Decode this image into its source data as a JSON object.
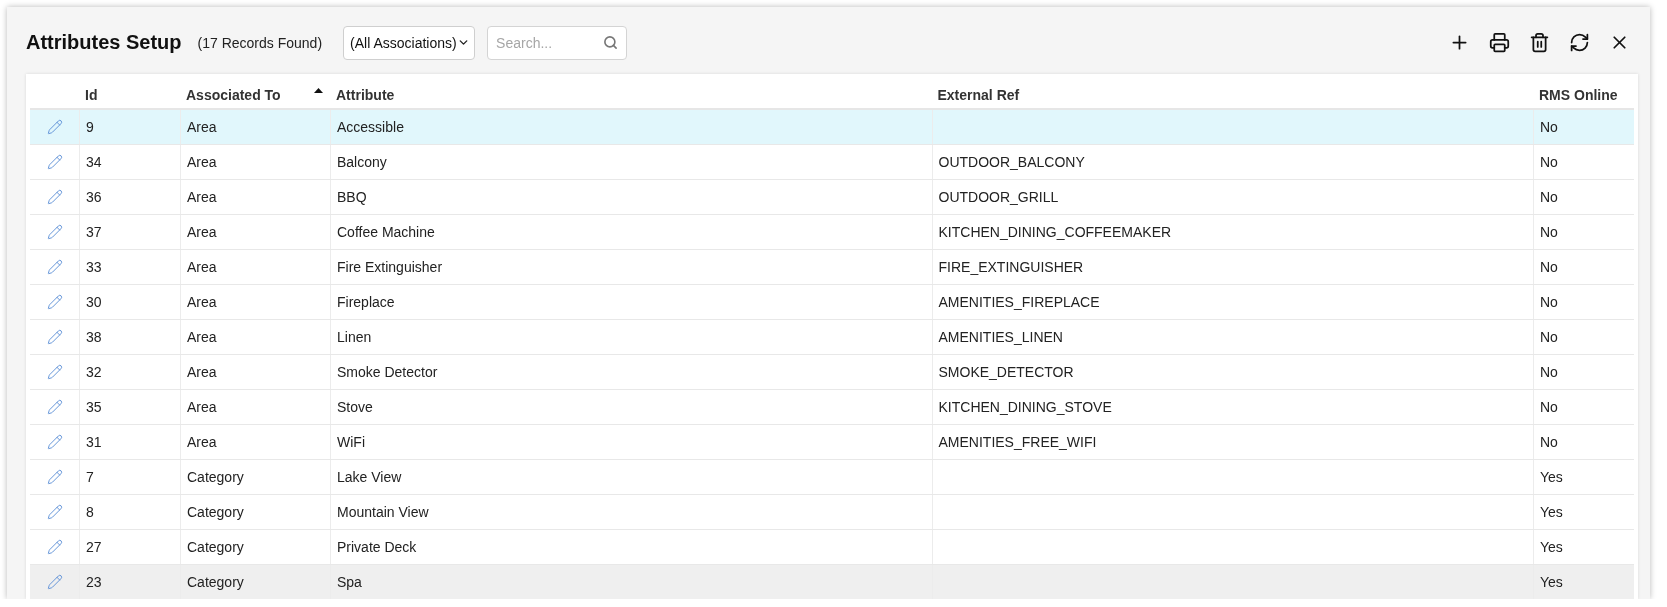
{
  "header": {
    "title": "Attributes Setup",
    "record_count": "(17 Records Found)",
    "association_filter": {
      "value": "(All Associations)"
    },
    "search": {
      "placeholder": "Search..."
    },
    "toolbar": [
      {
        "kind": "add"
      },
      {
        "kind": "print"
      },
      {
        "kind": "delete"
      },
      {
        "kind": "refresh"
      },
      {
        "kind": "close"
      }
    ]
  },
  "table": {
    "columns": [
      {
        "label": "Id",
        "sorted": false
      },
      {
        "label": "Associated To",
        "sorted": true
      },
      {
        "label": "Attribute",
        "sorted": false
      },
      {
        "label": "External Ref",
        "sorted": false
      },
      {
        "label": "RMS Online",
        "sorted": false
      }
    ],
    "rows": [
      {
        "id": "9",
        "associated_to": "Area",
        "attribute": "Accessible",
        "rms_online": "No",
        "selected": true,
        "hovered": false
      },
      {
        "id": "34",
        "associated_to": "Area",
        "attribute": "Balcony",
        "external_ref": "OUTDOOR_BALCONY",
        "rms_online": "No",
        "selected": false,
        "hovered": false
      },
      {
        "id": "36",
        "associated_to": "Area",
        "attribute": "BBQ",
        "external_ref": "OUTDOOR_GRILL",
        "rms_online": "No",
        "selected": false,
        "hovered": false
      },
      {
        "id": "37",
        "associated_to": "Area",
        "attribute": "Coffee Machine",
        "external_ref": "KITCHEN_DINING_COFFEEMAKER",
        "rms_online": "No",
        "selected": false,
        "hovered": false
      },
      {
        "id": "33",
        "associated_to": "Area",
        "attribute": "Fire Extinguisher",
        "external_ref": "FIRE_EXTINGUISHER",
        "rms_online": "No",
        "selected": false,
        "hovered": false
      },
      {
        "id": "30",
        "associated_to": "Area",
        "attribute": "Fireplace",
        "external_ref": "AMENITIES_FIREPLACE",
        "rms_online": "No",
        "selected": false,
        "hovered": false
      },
      {
        "id": "38",
        "associated_to": "Area",
        "attribute": "Linen",
        "external_ref": "AMENITIES_LINEN",
        "rms_online": "No",
        "selected": false,
        "hovered": false
      },
      {
        "id": "32",
        "associated_to": "Area",
        "attribute": "Smoke Detector",
        "external_ref": "SMOKE_DETECTOR",
        "rms_online": "No",
        "selected": false,
        "hovered": false
      },
      {
        "id": "35",
        "associated_to": "Area",
        "attribute": "Stove",
        "external_ref": "KITCHEN_DINING_STOVE",
        "rms_online": "No",
        "selected": false,
        "hovered": false
      },
      {
        "id": "31",
        "associated_to": "Area",
        "attribute": "WiFi",
        "external_ref": "AMENITIES_FREE_WIFI",
        "rms_online": "No",
        "selected": false,
        "hovered": false
      },
      {
        "id": "7",
        "associated_to": "Category",
        "attribute": "Lake View",
        "rms_online": "Yes",
        "selected": false,
        "hovered": false
      },
      {
        "id": "8",
        "associated_to": "Category",
        "attribute": "Mountain View",
        "rms_online": "Yes",
        "selected": false,
        "hovered": false
      },
      {
        "id": "27",
        "associated_to": "Category",
        "attribute": "Private Deck",
        "rms_online": "Yes",
        "selected": false,
        "hovered": false
      },
      {
        "id": "23",
        "associated_to": "Category",
        "attribute": "Spa",
        "rms_online": "Yes",
        "selected": false,
        "hovered": true
      }
    ]
  }
}
